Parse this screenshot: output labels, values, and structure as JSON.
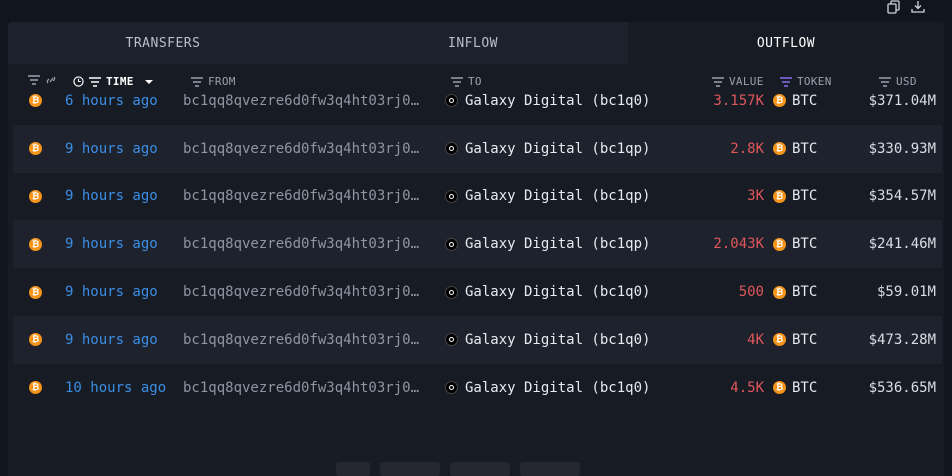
{
  "tabs": [
    {
      "label": "TRANSFERS",
      "active": false
    },
    {
      "label": "INFLOW",
      "active": false
    },
    {
      "label": "OUTFLOW",
      "active": true
    }
  ],
  "columns": {
    "time": "TIME",
    "from": "FROM",
    "to": "TO",
    "value": "VALUE",
    "token": "TOKEN",
    "usd": "USD"
  },
  "rows": [
    {
      "time": "6 hours ago",
      "from": "bc1qq8qvezre6d0fw3q4ht03rj0…",
      "to": "Galaxy Digital (bc1q0)",
      "value": "3.157K",
      "token": "BTC",
      "usd": "$371.04M"
    },
    {
      "time": "9 hours ago",
      "from": "bc1qq8qvezre6d0fw3q4ht03rj0…",
      "to": "Galaxy Digital (bc1qp)",
      "value": "2.8K",
      "token": "BTC",
      "usd": "$330.93M"
    },
    {
      "time": "9 hours ago",
      "from": "bc1qq8qvezre6d0fw3q4ht03rj0…",
      "to": "Galaxy Digital (bc1qp)",
      "value": "3K",
      "token": "BTC",
      "usd": "$354.57M"
    },
    {
      "time": "9 hours ago",
      "from": "bc1qq8qvezre6d0fw3q4ht03rj0…",
      "to": "Galaxy Digital (bc1qp)",
      "value": "2.043K",
      "token": "BTC",
      "usd": "$241.46M"
    },
    {
      "time": "9 hours ago",
      "from": "bc1qq8qvezre6d0fw3q4ht03rj0…",
      "to": "Galaxy Digital (bc1q0)",
      "value": "500",
      "token": "BTC",
      "usd": "$59.01M"
    },
    {
      "time": "9 hours ago",
      "from": "bc1qq8qvezre6d0fw3q4ht03rj0…",
      "to": "Galaxy Digital (bc1q0)",
      "value": "4K",
      "token": "BTC",
      "usd": "$473.28M"
    },
    {
      "time": "10 hours ago",
      "from": "bc1qq8qvezre6d0fw3q4ht03rj0…",
      "to": "Galaxy Digital (bc1q0)",
      "value": "4.5K",
      "token": "BTC",
      "usd": "$536.65M"
    }
  ],
  "colors": {
    "background": "#11151d",
    "panel": "#171b24",
    "row_alt": "#1e222c",
    "time_link": "#3b8ee6",
    "value_outflow": "#e0575b",
    "btc": "#f7931a",
    "token_filter_active": "#8b6cf0"
  },
  "icons": {
    "copy": "copy-icon",
    "download": "download-icon",
    "filter": "filter-icon",
    "link": "link-icon",
    "clock": "clock-icon",
    "sort": "sort-desc-icon",
    "btc": "bitcoin-icon",
    "entity": "galaxy-digital-icon"
  }
}
